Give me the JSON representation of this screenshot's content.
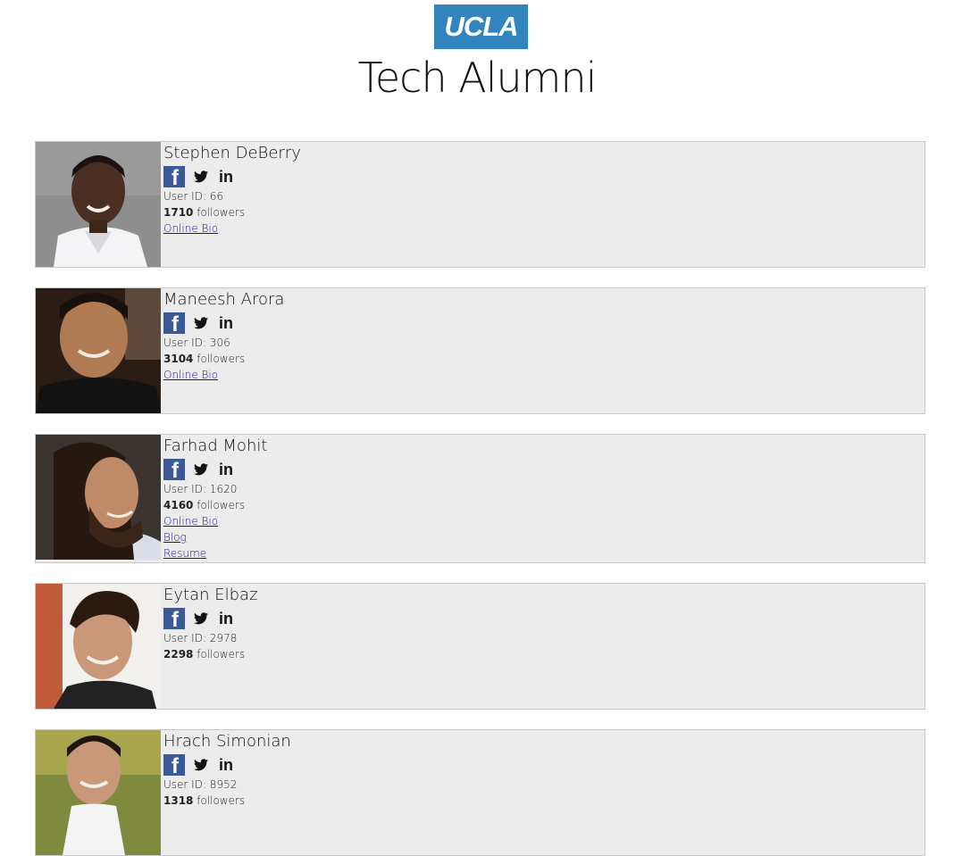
{
  "header": {
    "logo_text": "UCLA",
    "title": "Tech Alumni"
  },
  "profiles": [
    {
      "name": "Stephen DeBerry",
      "user_id_label": "User ID: 66",
      "followers_count": "1710",
      "followers_label": " followers",
      "links": [
        "Online Bio"
      ]
    },
    {
      "name": "Maneesh Arora",
      "user_id_label": "User ID: 306",
      "followers_count": "3104",
      "followers_label": " followers",
      "links": [
        "Online Bio"
      ]
    },
    {
      "name": "Farhad Mohit",
      "user_id_label": "User ID: 1620",
      "followers_count": "4160",
      "followers_label": " followers",
      "links": [
        "Online Bio",
        "Blog",
        "Resume"
      ]
    },
    {
      "name": "Eytan Elbaz",
      "user_id_label": "User ID: 2978",
      "followers_count": "2298",
      "followers_label": " followers",
      "links": []
    },
    {
      "name": "Hrach Simonian",
      "user_id_label": "User ID: 8952",
      "followers_count": "1318",
      "followers_label": " followers",
      "links": []
    }
  ],
  "social_icons": [
    "facebook-icon",
    "twitter-icon",
    "linkedin-icon"
  ],
  "colors": {
    "logo_bg": "#3284bf",
    "card_bg": "#ececec",
    "facebook": "#3b5998",
    "link": "#1a0dab"
  }
}
